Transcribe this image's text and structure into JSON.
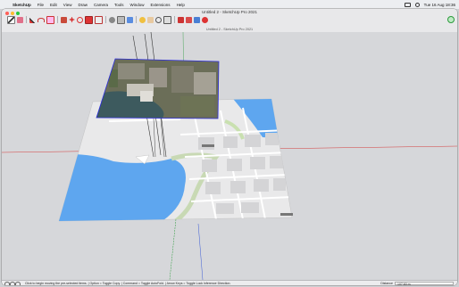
{
  "menubar": {
    "app": "SketchUp",
    "items": [
      "File",
      "Edit",
      "View",
      "Draw",
      "Camera",
      "Tools",
      "Window",
      "Extensions",
      "Help"
    ],
    "clock": "Tue 16 Aug  18:36"
  },
  "window": {
    "title": "Untitled 2 - SketchUp Pro 2021",
    "subtitle": "Untitled 2 - SketchUp Pro 2021"
  },
  "statusbar": {
    "hint": "Click to begin moving the pre-selected items. | Option = Toggle Copy. | Command = Toggle AutoFold. | Arrow Keys = Toggle Lock Inference Direction.",
    "measurement_label": "Distance",
    "measurement_value": "107.60 m"
  },
  "icons": {
    "toolbar": [
      "select-icon",
      "eraser-icon",
      "pencil-icon",
      "arc-icon",
      "rectangle-icon",
      "push-pull-icon",
      "move-icon",
      "rotate-icon",
      "scale-icon",
      "offset-icon",
      "tape-measure-icon",
      "text-icon",
      "paint-bucket-icon",
      "orbit-icon",
      "pan-icon",
      "zoom-icon",
      "zoom-extents-icon",
      "warehouse-icon",
      "extension-warehouse-icon",
      "layout-icon",
      "model-info-icon"
    ]
  },
  "colors": {
    "accent_selection": "#2c2ce0",
    "water": "#5ea6ef",
    "map_base": "#eaeaea",
    "axis_red": "#d43c3c",
    "axis_green": "#2a9b3a",
    "axis_blue": "#3a5bd6"
  }
}
